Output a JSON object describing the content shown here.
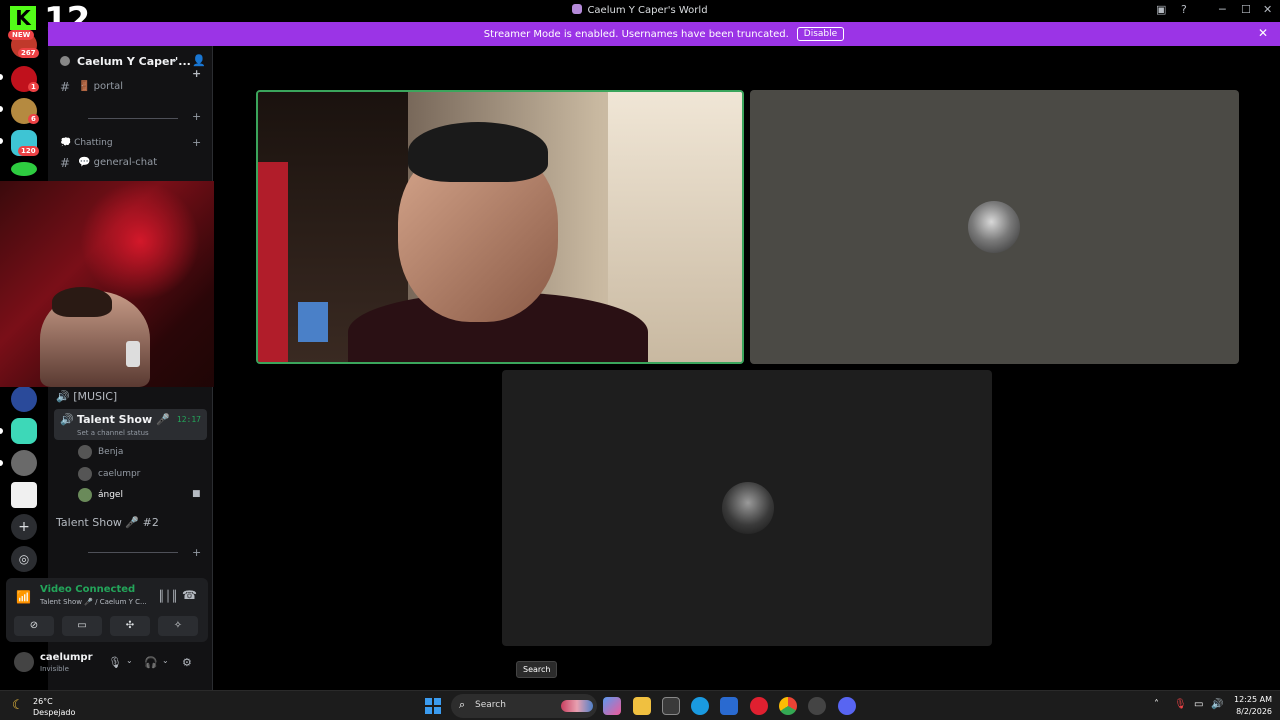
{
  "window": {
    "title": "Caelum Y Caper's World"
  },
  "overlay": {
    "number": "12",
    "new_badge": "NEW"
  },
  "streamer": {
    "message": "Streamer Mode is enabled. Usernames have been truncated.",
    "disable_label": "Disable"
  },
  "rail_badges": [
    "267",
    "1",
    "6",
    "120"
  ],
  "guild": {
    "name": "Caelum Y Caper'..."
  },
  "channels": {
    "portal": "🚪 portal",
    "category_chatting": "💭 Chatting",
    "general_chat": "💬 general-chat",
    "music": "🔊 [MUSIC]",
    "talent_show": "Talent Show 🎤",
    "talent_show_time": "12:17",
    "talent_show_status": "Set a channel status",
    "talent_show_2": "Talent Show 🎤 #2"
  },
  "members": [
    "Benja",
    "caelumpr",
    "ángel"
  ],
  "voice": {
    "connected": "Video Connected",
    "location": "Talent Show 🎤 / Caelum Y C..."
  },
  "user": {
    "name": "caelumpr",
    "status": "Invisible"
  },
  "tooltip": "Search",
  "taskbar": {
    "temp": "26°C",
    "condition": "Despejado",
    "search_placeholder": "Search",
    "time": "12:25 AM",
    "date": "8/2/2026"
  },
  "colors": {
    "streamer_bar": "#9b34e6",
    "speaking": "#3ba55c",
    "kick_green": "#53fc18"
  }
}
